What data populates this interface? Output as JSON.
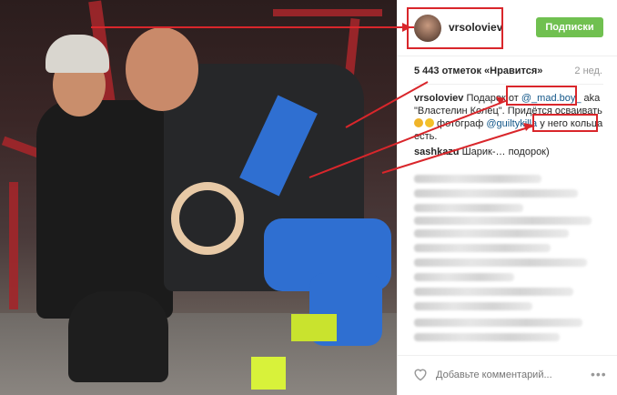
{
  "header": {
    "username": "vrsoloviev",
    "follow_label": "Подписки"
  },
  "stats": {
    "likes_text": "5 443 отметок «Нравится»",
    "age_text": "2 нед."
  },
  "caption": {
    "user": "vrsoloviev",
    "part1": " Подарок от ",
    "mention1": "@_mad.boy_",
    "part2": " aka \"Властелин Колец\". Придётся осваивать ",
    "part3": " фотограф ",
    "mention2": "@guiltykilla",
    "part4": " у него кольца есть."
  },
  "first_comment": {
    "user": "sashkazu",
    "text": " Шарик-… подорок)"
  },
  "comment_input": {
    "placeholder": "Добавьте комментарий..."
  },
  "icons": {
    "heart": "heart-icon",
    "more": "more-options-icon",
    "emoji_bicep": "bicep-emoji-icon",
    "emoji_smile": "smile-emoji-icon"
  },
  "colors": {
    "follow_button": "#70c050",
    "mention": "#125688",
    "annotation_red": "#d9262b"
  }
}
